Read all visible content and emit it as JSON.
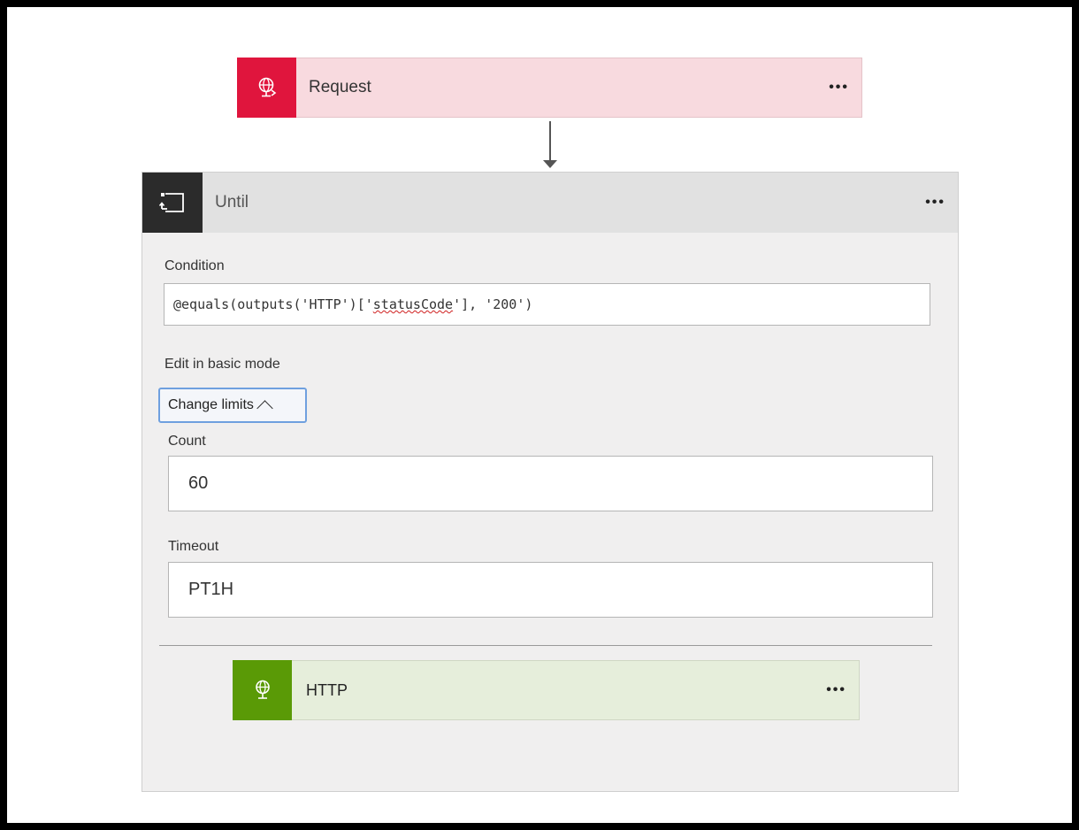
{
  "request": {
    "title": "Request",
    "menu": "•••",
    "icon": "globe-request-icon",
    "accent": "#e0153d",
    "background": "#f8dadf"
  },
  "until": {
    "title": "Until",
    "menu": "•••",
    "icon": "loop-until-icon",
    "condition_label": "Condition",
    "condition_prefix": "@equals(outputs('HTTP')['",
    "condition_misspelled": "statusCode",
    "condition_suffix": "'], '200')",
    "basic_mode_link": "Edit in basic mode",
    "change_limits_label": "Change limits",
    "count_label": "Count",
    "count_value": "60",
    "timeout_label": "Timeout",
    "timeout_value": "PT1H"
  },
  "http": {
    "title": "HTTP",
    "menu": "•••",
    "icon": "globe-http-icon",
    "accent": "#5a9a06",
    "background": "#e6eedb"
  }
}
